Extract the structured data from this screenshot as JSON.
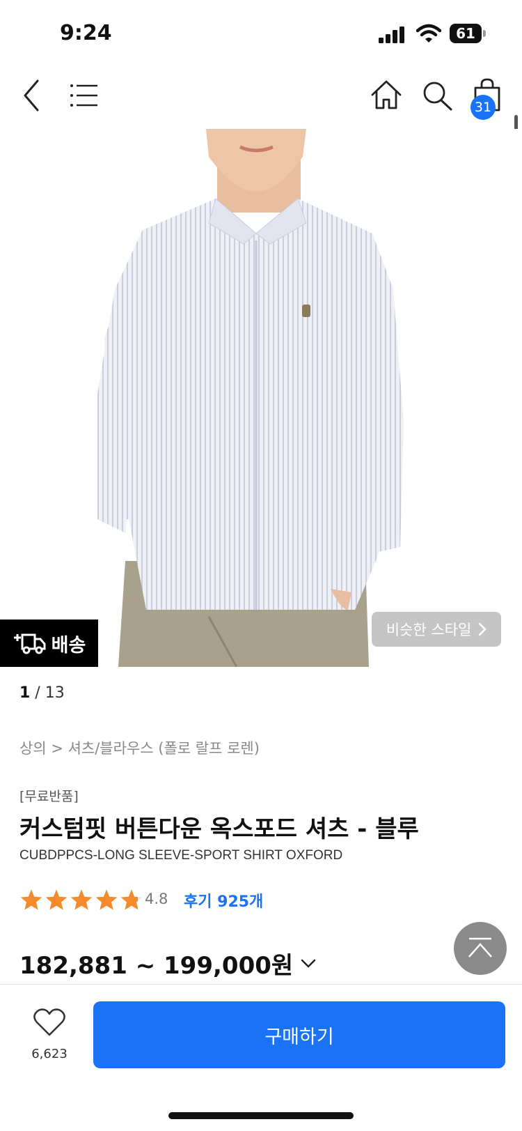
{
  "status_bar": {
    "time": "9:24",
    "battery": "61"
  },
  "header": {
    "cart_count": "31"
  },
  "image": {
    "delivery_label": "배송",
    "similar_style_label": "비슷한 스타일"
  },
  "pager": {
    "current": "1",
    "separator": " / ",
    "total": "13"
  },
  "breadcrumb": "상의 > 셔츠/블라우스 (폴로 랄프 로렌)",
  "product": {
    "badge": "[무료반품]",
    "title": "커스텀핏 버튼다운 옥스포드 셔츠 - 블루",
    "subtitle": "CUBDPPCS-LONG SLEEVE-SPORT SHIRT OXFORD",
    "rating": "4.8",
    "rating_value": 4.8,
    "reviews": "후기 925개",
    "price": "182,881 ~ 199,000원"
  },
  "bottom_bar": {
    "like_count": "6,623",
    "buy_label": "구매하기"
  },
  "colors": {
    "accent": "#1a73f5",
    "star": "#f58a2a"
  },
  "icons": [
    "back-icon",
    "menu-icon",
    "home-icon",
    "search-icon",
    "shopping-bag-icon",
    "truck-icon",
    "chevron-right-icon",
    "chevron-down-icon",
    "scroll-top-icon",
    "heart-icon"
  ]
}
